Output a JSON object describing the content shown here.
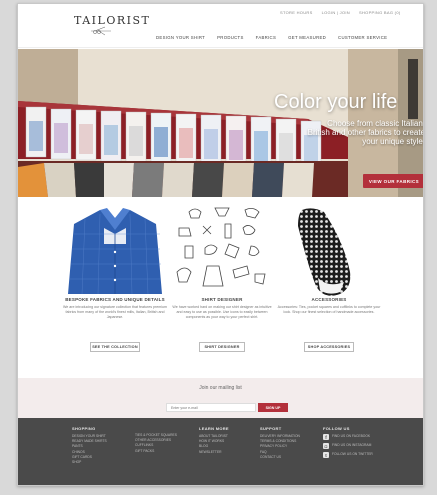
{
  "brand": {
    "name": "TAILORIST"
  },
  "utility_links": [
    "STORE HOURS",
    "LOGIN | JOIN",
    "SHOPPING BAG (0)"
  ],
  "nav": [
    "DESIGN YOUR SHIRT",
    "PRODUCTS",
    "FABRICS",
    "GET MEASURED",
    "CUSTOMER SERVICE"
  ],
  "hero": {
    "title": "Color your life",
    "subtitle": "Choose from classic Italian, British and other fabrics to create your unique style.",
    "button": "VIEW OUR FABRICS"
  },
  "features": [
    {
      "title": "BESPOKE FABRICS AND UNIQUE DETAILS",
      "desc": "We are introducing our signature collection that features premium fabrics from many of the world's finest mills, Italian, British and Japanese.",
      "button": "SEE THE COLLECTION"
    },
    {
      "title": "SHIRT DESIGNER",
      "desc": "We have worked hard on making our shirt designer as intuitive and easy to use as possible. Use icons to easily between components as your way to your perfect shirt.",
      "button": "SHIRT DESIGNER"
    },
    {
      "title": "ACCESSORIES",
      "desc": "Accessories: Ties, pocket squares and cufflinks to complete your look. Shop our finest selection of handmade accessories.",
      "button": "SHOP ACCESSORIES"
    }
  ],
  "mailing": {
    "title": "Join our mailing list",
    "placeholder": "Enter your e-mail",
    "button": "SIGN UP"
  },
  "footer": {
    "columns": [
      {
        "heading": "SHOPPING",
        "items": [
          "DESIGN YOUR SHIRT",
          "READY MADE SHIRTS",
          "PANTS",
          "CHINOS",
          "GIFT CARDS",
          "SHOP"
        ]
      },
      {
        "heading": "",
        "items": [
          "TIES & POCKET SQUARES",
          "OTHER ACCESSORIES",
          "CUFFLINKS",
          "GIFT PACKS"
        ]
      },
      {
        "heading": "LEARN MORE",
        "items": [
          "ABOUT TAILORIST",
          "HOW IT WORKS",
          "BLOG",
          "NEWSLETTER"
        ]
      },
      {
        "heading": "SUPPORT",
        "items": [
          "DELIVERY INFORMATION",
          "TERMS & CONDITIONS",
          "PRIVACY POLICY",
          "FAQ",
          "CONTACT US"
        ]
      }
    ],
    "follow": {
      "heading": "FOLLOW US",
      "items": [
        "FIND US ON FACEBOOK",
        "FIND US ON INSTAGRAM",
        "FOLLOW US ON TWITTER"
      ]
    }
  },
  "colors": {
    "accent": "#b3303b",
    "footer_bg": "#4a4a4a",
    "mailing_bg": "#f3ecec"
  },
  "icons": [
    "tailor-scissors-logo",
    "facebook-icon",
    "instagram-icon",
    "twitter-icon"
  ]
}
